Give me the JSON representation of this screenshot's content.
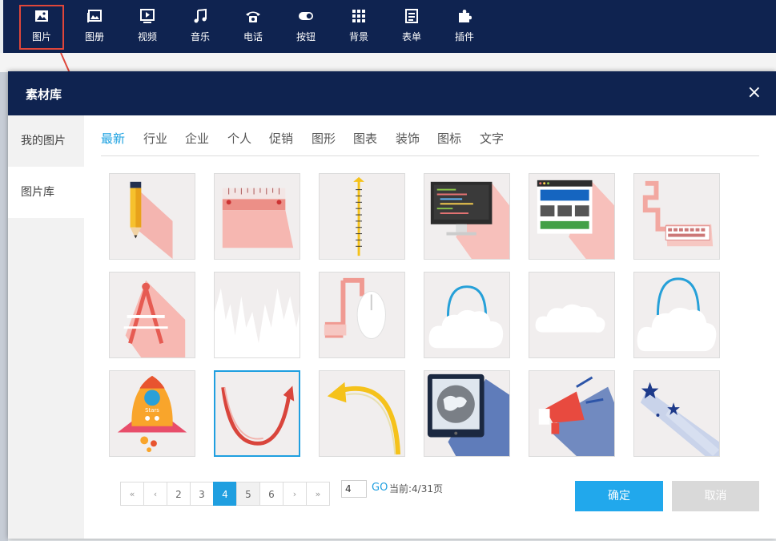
{
  "toolbar": {
    "items": [
      {
        "label": "图片"
      },
      {
        "label": "图册"
      },
      {
        "label": "视频"
      },
      {
        "label": "音乐"
      },
      {
        "label": "电话"
      },
      {
        "label": "按钮"
      },
      {
        "label": "背景"
      },
      {
        "label": "表单"
      },
      {
        "label": "插件"
      }
    ]
  },
  "modal": {
    "title": "素材库",
    "close": "×",
    "sidebar": [
      {
        "label": "我的图片"
      },
      {
        "label": "图片库"
      }
    ],
    "tabs": [
      {
        "label": "最新"
      },
      {
        "label": "行业"
      },
      {
        "label": "企业"
      },
      {
        "label": "个人"
      },
      {
        "label": "促销"
      },
      {
        "label": "图形"
      },
      {
        "label": "图表"
      },
      {
        "label": "装饰"
      },
      {
        "label": "图标"
      },
      {
        "label": "文字"
      }
    ],
    "pager": {
      "first": "«",
      "prev": "‹",
      "pages": [
        "2",
        "3",
        "4",
        "5",
        "6"
      ],
      "next": "›",
      "last": "»",
      "input_value": "4",
      "go": "GO",
      "current": "当前:4/31页"
    },
    "confirm": "确定",
    "cancel": "取消",
    "thumb_text": {
      "rocket_badge": "Stars"
    }
  },
  "colors": {
    "navy": "#0f2350",
    "accent": "#1f9fe0",
    "highlight": "#e0463a",
    "confirm": "#21a8ec",
    "cancel": "#d9d9d9"
  }
}
